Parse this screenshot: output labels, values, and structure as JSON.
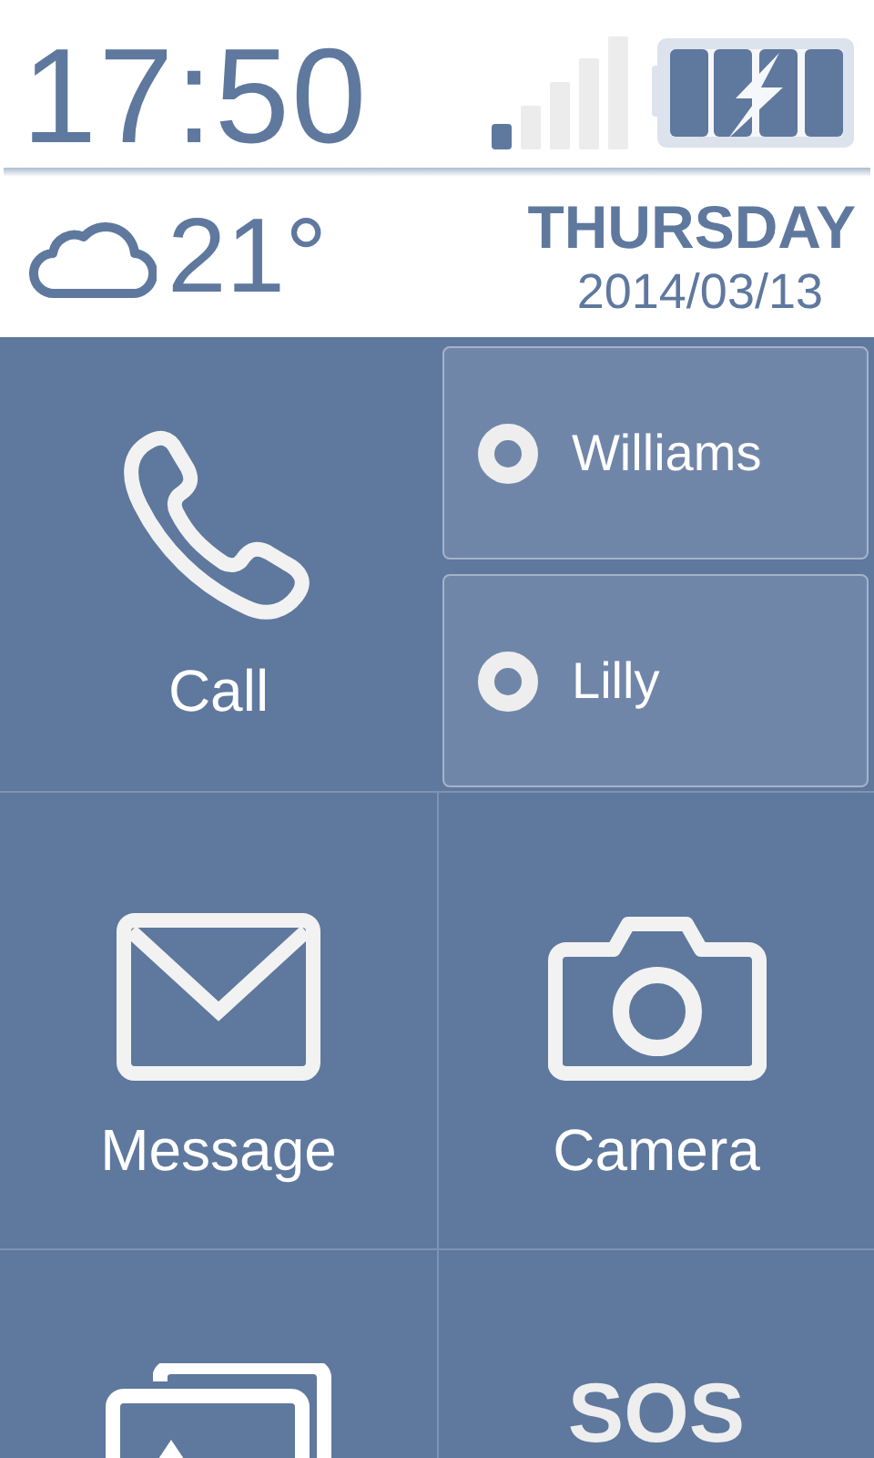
{
  "status": {
    "time": "17:50",
    "charging": true
  },
  "weather": {
    "temperature": "21°"
  },
  "date": {
    "weekday": "THURSDAY",
    "date": "2014/03/13"
  },
  "call": {
    "label": "Call"
  },
  "favorites": [
    {
      "name": "Williams"
    },
    {
      "name": "Lilly"
    }
  ],
  "tiles": [
    {
      "kind": "message",
      "label": "Message"
    },
    {
      "kind": "camera",
      "label": "Camera"
    },
    {
      "kind": "gallery"
    },
    {
      "kind": "sos",
      "label": "SOS"
    }
  ]
}
